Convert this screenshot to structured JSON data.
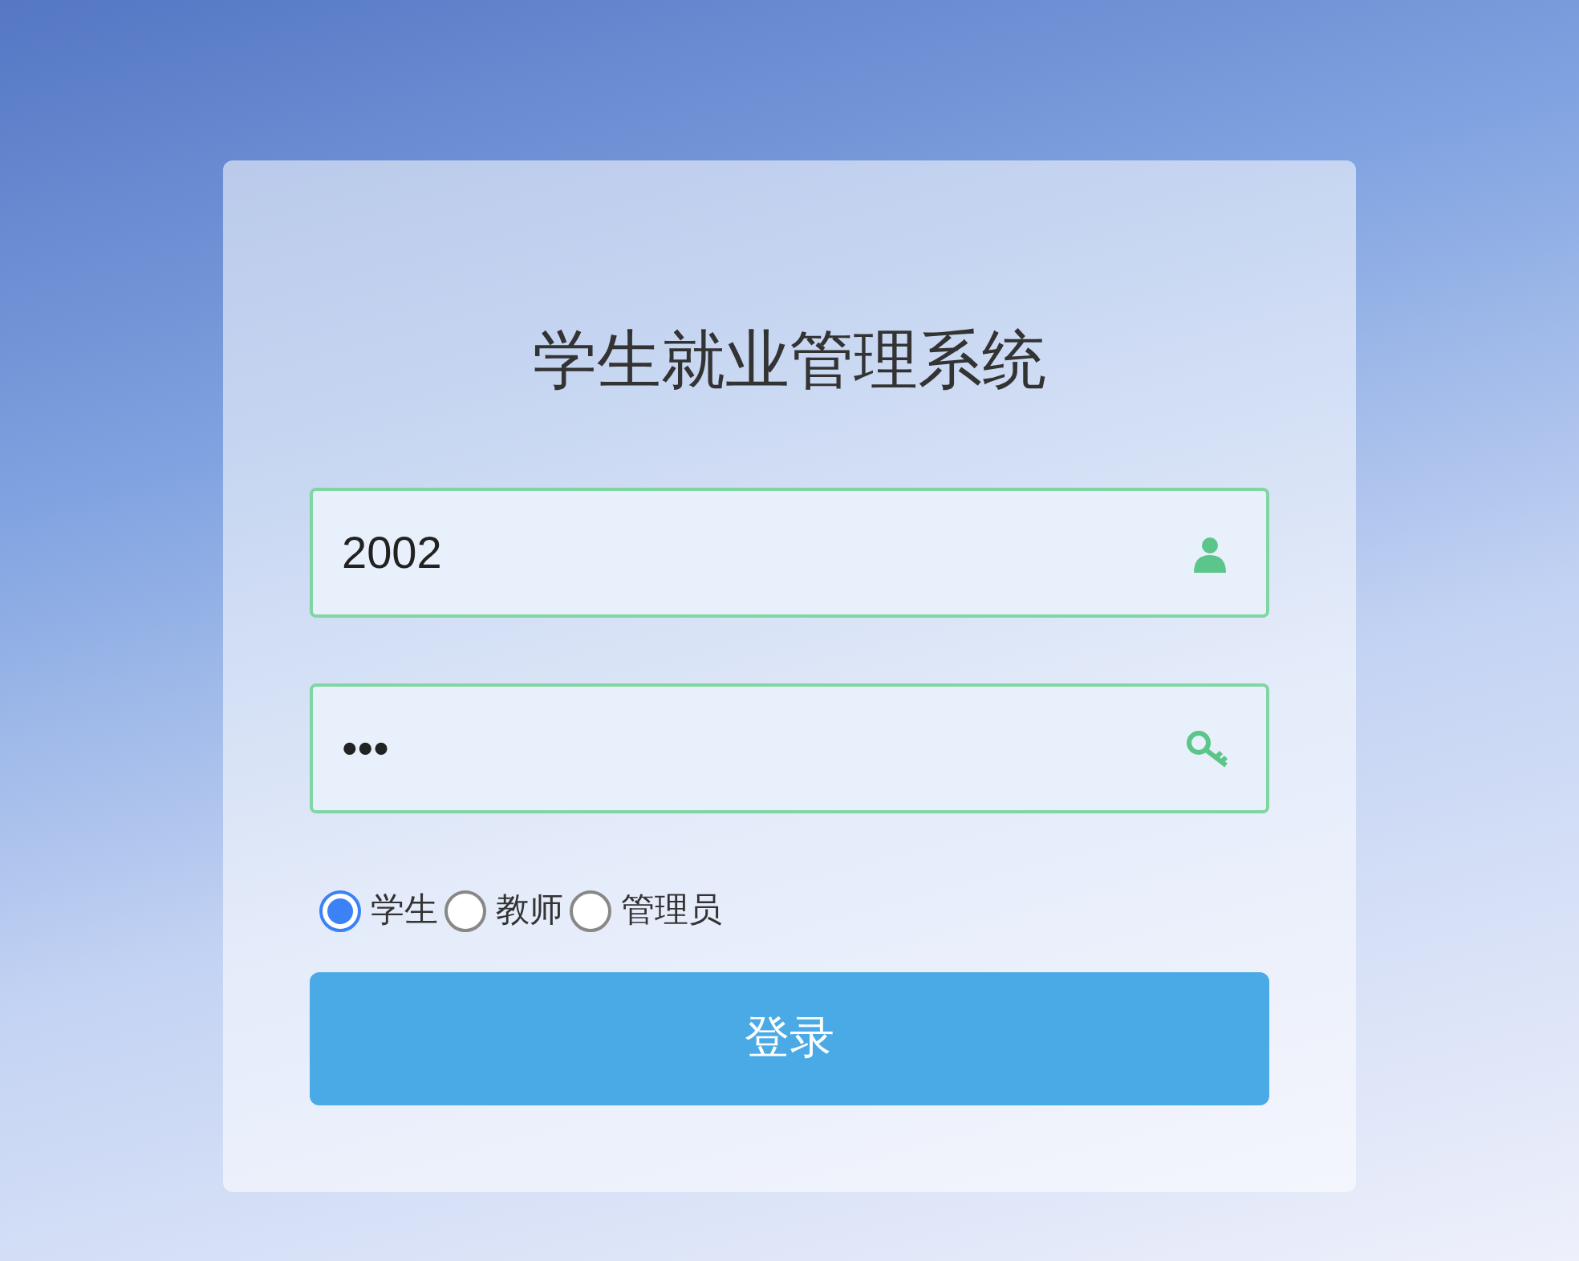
{
  "title": "学生就业管理系统",
  "username": {
    "value": "2002"
  },
  "password": {
    "value": "•••"
  },
  "roles": [
    {
      "label": "学生",
      "selected": true
    },
    {
      "label": "教师",
      "selected": false
    },
    {
      "label": "管理员",
      "selected": false
    }
  ],
  "login_button": "登录"
}
